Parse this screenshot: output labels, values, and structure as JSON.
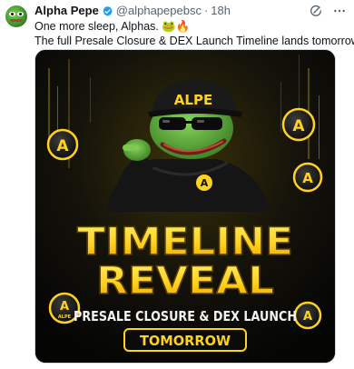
{
  "tweet": {
    "display_name": "Alpha Pepe",
    "handle": "@alphapepebsc",
    "separator": "·",
    "time": "18h",
    "line1": "One more sleep, Alphas. 🐸🔥",
    "line2": "The full Presale Closure & DEX Launch Timeline lands tomorrow."
  },
  "image": {
    "cap_label": "ALPE",
    "hoodie_badge": "A",
    "coin_letter": "A",
    "coin_label": "ALPE",
    "title_line1": "TIMELINE",
    "title_line2": "REVEAL",
    "subtitle": "PRESALE CLOSURE & DEX LAUNCH",
    "badge": "TOMORROW"
  },
  "icons": {
    "verified": "verified-badge-icon",
    "grok": "grok-icon",
    "more": "more-options-icon"
  },
  "colors": {
    "verified_blue": "#1d9bf0",
    "accent_yellow": "#ffd21f",
    "pepe_green": "#5fae3e"
  }
}
